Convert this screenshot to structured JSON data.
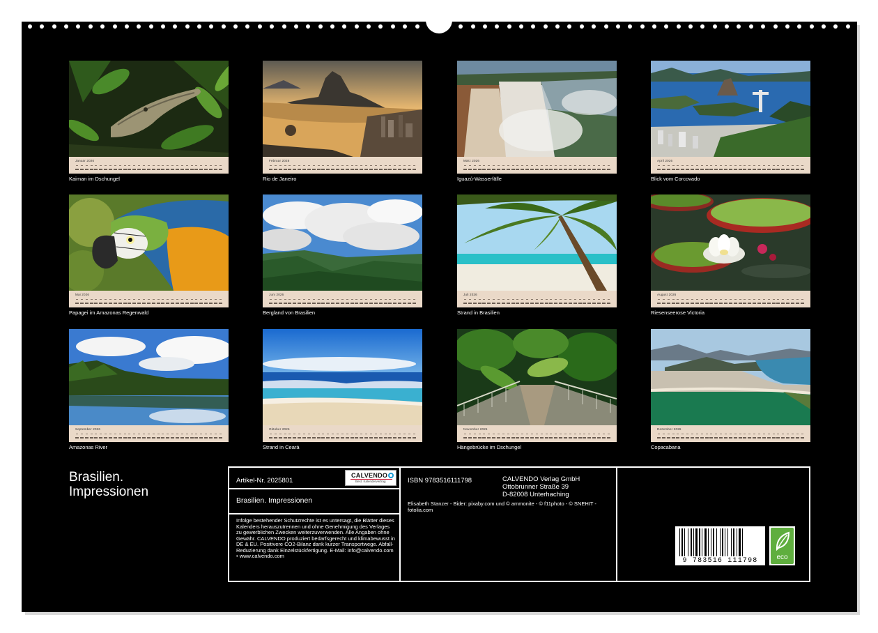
{
  "calendar_title_line1": "Brasilien.",
  "calendar_title_line2": "Impressionen",
  "months": [
    {
      "month_label": "Januar 2026",
      "caption": "Kaiman im Dschungel"
    },
    {
      "month_label": "Februar 2026",
      "caption": "Rio de Janeiro"
    },
    {
      "month_label": "März 2026",
      "caption": "Iguazú-Wasserfälle"
    },
    {
      "month_label": "April 2026",
      "caption": "Blick vom Corcovado"
    },
    {
      "month_label": "Mai 2026",
      "caption": "Papagei im Amazonas Regenwald"
    },
    {
      "month_label": "Juni 2026",
      "caption": "Bergland von Brasilien"
    },
    {
      "month_label": "Juli 2026",
      "caption": "Strand in Brasilien"
    },
    {
      "month_label": "August 2026",
      "caption": "Riesenseerose Victoria"
    },
    {
      "month_label": "September 2026",
      "caption": "Amazonas River"
    },
    {
      "month_label": "Oktober 2026",
      "caption": "Strand in Ceará"
    },
    {
      "month_label": "November 2026",
      "caption": "Hängebrücke im Dschungel"
    },
    {
      "month_label": "Dezember 2026",
      "caption": "Copacabana"
    }
  ],
  "info": {
    "article_number": "Artikel-Nr. 2025801",
    "logo_brand": "CALVENDO",
    "logo_sub": "Best. Kalendervertrag",
    "product_title": "Brasilien. Impressionen",
    "legal_text": "Infolge bestehender Schutzrechte ist es untersagt, die Blätter dieses Kalenders herauszutrennen und ohne Genehmigung des Verlages zu gewerblichen Zwecken weiterzuverwenden. Alle Angaben ohne Gewähr. CALVENDO produziert bedarfsgerecht und klimabewusst in DE & EU. Positivere CO2-Bilanz dank kurzer Transportwege. Abfall-Reduzierung dank Einzelstückfertigung. E-Mail: info@calvendo.com • www.calvendo.com",
    "isbn": "ISBN 9783516111798",
    "publisher_name": "CALVENDO Verlag GmbH",
    "publisher_street": "Ottobrunner Straße 39",
    "publisher_city": "D-82008 Unterhaching",
    "credits": "Elisabeth Stanzer - Bider: pixaby.com und © ammonite - © f11photo - © SNEHIT - fotolia.com",
    "barcode_number": "9 783516 111798",
    "eco_label": "eco"
  }
}
